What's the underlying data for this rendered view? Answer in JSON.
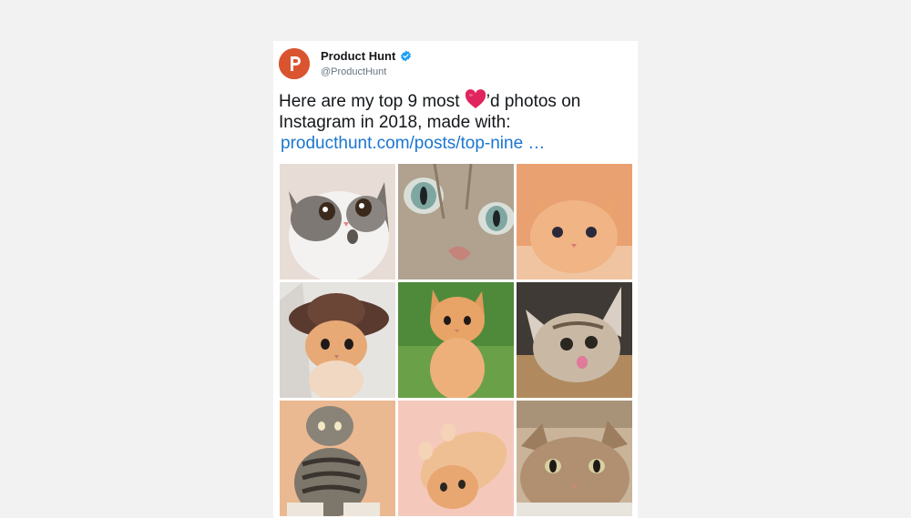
{
  "tweet": {
    "author_name": "Product Hunt",
    "author_handle": "@ProductHunt",
    "avatar_letter": "P",
    "text_part1": "Here are my top 9 most ",
    "text_part2": "’d photos on Instagram in 2018, made with:",
    "link_text": "producthunt.com/posts/top-nine …",
    "heart_icon": "red-heart-emoji"
  },
  "photos": [
    {
      "label": "kitten-1"
    },
    {
      "label": "kitten-2"
    },
    {
      "label": "kitten-3"
    },
    {
      "label": "kitten-4"
    },
    {
      "label": "kitten-5"
    },
    {
      "label": "kitten-6"
    },
    {
      "label": "kitten-7"
    },
    {
      "label": "kitten-8"
    },
    {
      "label": "kitten-9"
    }
  ],
  "colors": {
    "brand": "#da552f",
    "link": "#1b76d1",
    "verified": "#1da1f2",
    "heart": "#e0245e"
  }
}
